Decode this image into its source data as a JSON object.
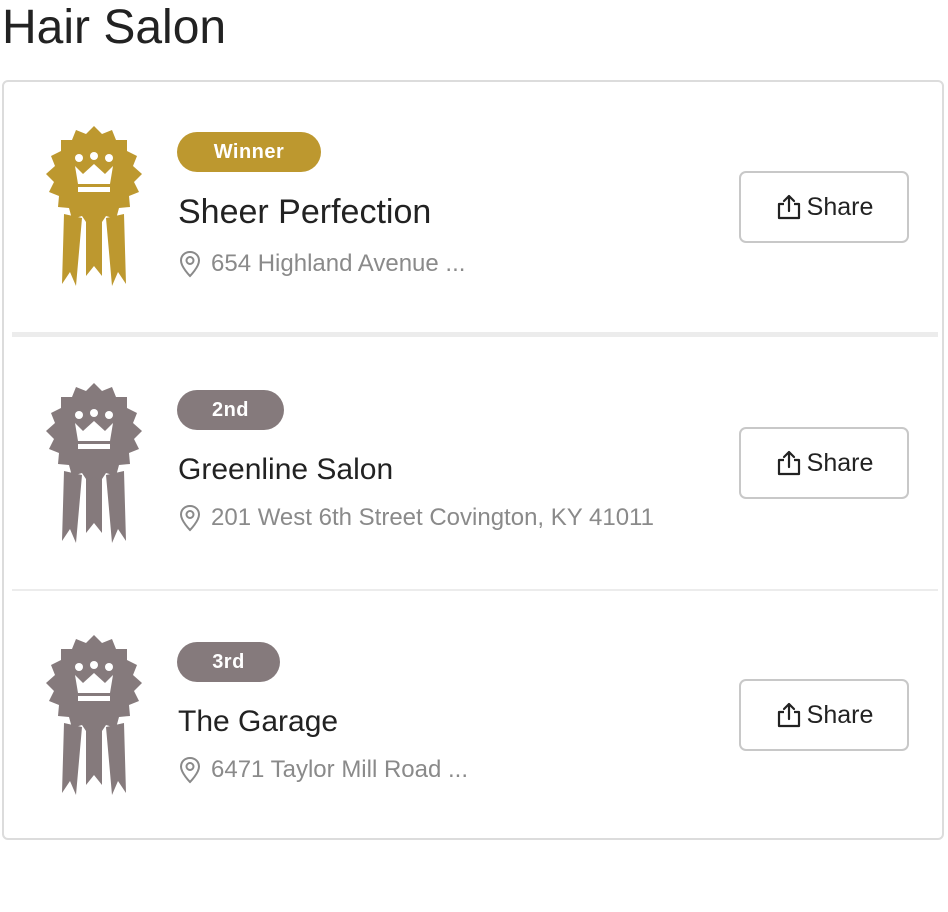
{
  "page": {
    "title": "Hair Salon"
  },
  "colors": {
    "winner": "#bd982f",
    "runner_up": "#857a7c",
    "address_text": "#8a8a8a",
    "divider": "#ececec"
  },
  "icons": {
    "award": "ribbon-award-icon",
    "crown": "crown-icon",
    "location": "map-pin-icon",
    "share": "share-icon"
  },
  "results": [
    {
      "badge": "Winner",
      "name": "Sheer Perfection",
      "address": "654 Highland Avenue ...",
      "share_label": "Share"
    },
    {
      "badge": "2nd",
      "name": "Greenline Salon",
      "address": "201 West 6th Street Covington, KY 41011",
      "share_label": "Share"
    },
    {
      "badge": "3rd",
      "name": "The Garage",
      "address": "6471 Taylor Mill Road ...",
      "share_label": "Share"
    }
  ]
}
